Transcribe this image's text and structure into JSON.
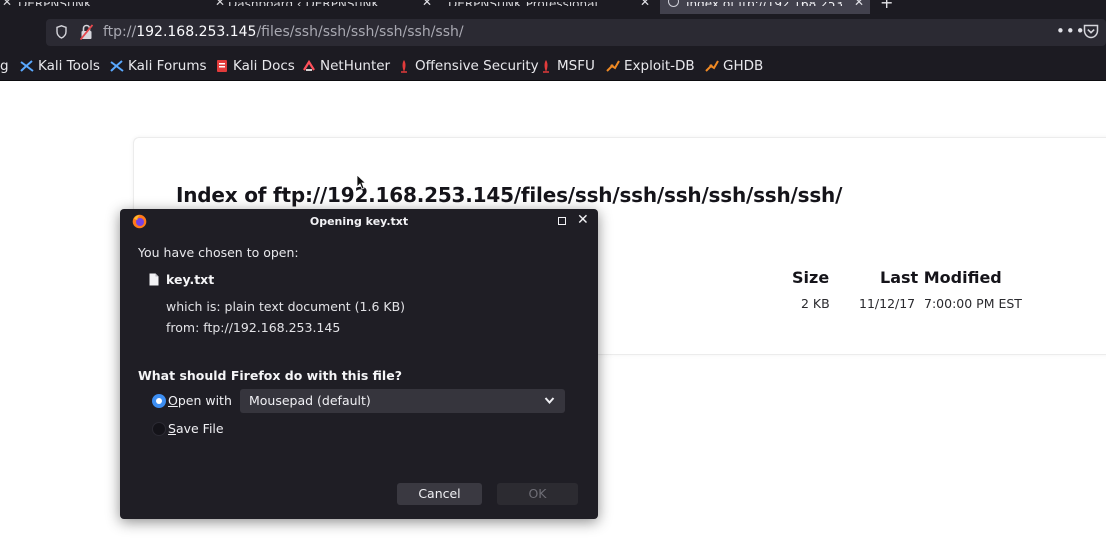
{
  "browser": {
    "tabs": [
      {
        "label": "DERPNStiNK"
      },
      {
        "label": "Dashboard ‹ DERPNStiNK"
      },
      {
        "label": "DERPNStiNK Professional"
      },
      {
        "label": "Index of ftp://192.168.253"
      }
    ],
    "address": {
      "scheme": "ftp://",
      "host": "192.168.253.145",
      "path": "/files/ssh/ssh/ssh/ssh/ssh/ssh/"
    },
    "bookmarks": [
      {
        "label": "Kali Tools",
        "icon": "kali-icon"
      },
      {
        "label": "Kali Forums",
        "icon": "kali-icon"
      },
      {
        "label": "Kali Docs",
        "icon": "kali-docs-icon"
      },
      {
        "label": "NetHunter",
        "icon": "nethunter-icon"
      },
      {
        "label": "Offensive Security",
        "icon": "offsec-icon"
      },
      {
        "label": "MSFU",
        "icon": "offsec-icon"
      },
      {
        "label": "Exploit-DB",
        "icon": "exploit-db-icon"
      },
      {
        "label": "GHDB",
        "icon": "exploit-db-icon"
      }
    ],
    "bookmark_partial": "g"
  },
  "listing": {
    "heading": "Index of ftp://192.168.253.145/files/ssh/ssh/ssh/ssh/ssh/ssh/",
    "columns": {
      "size": "Size",
      "modified": "Last Modified"
    },
    "row": {
      "size": "2 KB",
      "date": "11/12/17",
      "time": "7:00:00 PM EST"
    }
  },
  "dialog": {
    "title": "Opening key.txt",
    "chosen_label": "You have chosen to open:",
    "file_name": "key.txt",
    "file_type": "which is: plain text document (1.6 KB)",
    "file_from": "from: ftp://192.168.253.145",
    "question": "What should Firefox do with this file?",
    "open_with_label": "pen with",
    "open_with_accel": "O",
    "app_selected": "Mousepad (default)",
    "save_label": "ave File",
    "save_accel": "S",
    "cancel_label": "Cancel",
    "ok_label": "OK",
    "selected_option": "open-with"
  },
  "colors": {
    "chrome_bg": "#1c1b22",
    "dialog_bg": "#1f1e25",
    "accent": "#3d8ef2"
  }
}
